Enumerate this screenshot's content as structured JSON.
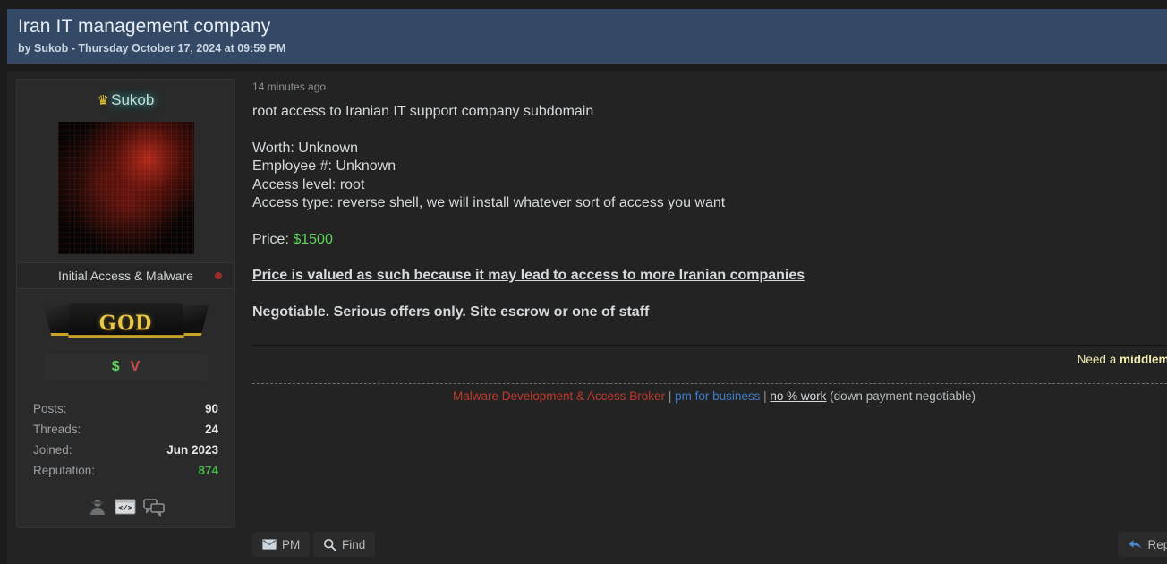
{
  "thread": {
    "title": "Iran IT management company",
    "byline": "by Sukob - Thursday October 17, 2024 at 09:59 PM"
  },
  "author": {
    "rank_icon": "crown-icon",
    "crown_glyph": "♛",
    "name": "Sukob",
    "usergroup": "Initial Access & Malware",
    "rank_banner_text": "GOD",
    "awards": [
      {
        "name": "money-award-icon",
        "glyph": "$",
        "color": "#5fd45f"
      },
      {
        "name": "vendor-award-icon",
        "glyph": "V",
        "color": "#cc4a4a"
      }
    ],
    "stats": [
      {
        "label": "Posts:",
        "value": "90"
      },
      {
        "label": "Threads:",
        "value": "24"
      },
      {
        "label": "Joined:",
        "value": "Jun 2023"
      },
      {
        "label": "Reputation:",
        "value": "874"
      }
    ],
    "icons": [
      "user-profile-icon",
      "code-icon",
      "chat-bubbles-icon"
    ]
  },
  "post": {
    "time": "14 minutes ago",
    "headline": "root access to Iranian IT support company subdomain",
    "details": [
      "Worth: Unknown",
      "Employee #: Unknown",
      "Access level: root",
      "Access type: reverse shell, we will install whatever sort of access you want"
    ],
    "price_label": "Price: ",
    "price_value": "$1500",
    "emphasis_underlined": "Price is valued as such because it may lead to access to more Iranian companies",
    "emphasis_bold": "Negotiable. Serious offers only. Site escrow or one of staff"
  },
  "signature": {
    "middleman_prefix": "Need a ",
    "middleman_bold": "middlema",
    "role": "Malware Development & Access Broker",
    "sep1": " | ",
    "pm_link": "pm for business",
    "sep2": " | ",
    "no_percent": "no % work",
    "tail": " (down payment negotiable)"
  },
  "footer": {
    "pm_label": "PM",
    "find_label": "Find",
    "reply_label": "Reply"
  },
  "colors": {
    "header_bg": "#344966",
    "page_bg": "#1b1b1b",
    "post_bg": "#232323",
    "accent_green": "#5fd45f",
    "accent_red": "#c0392b",
    "accent_blue": "#3d7ecc",
    "accent_yellow": "#f2eeb0",
    "rank_gold": "#e8c84a"
  }
}
